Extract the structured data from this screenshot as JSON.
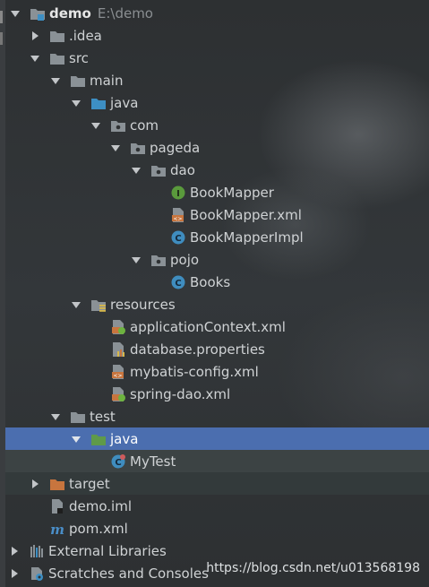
{
  "tree": {
    "root": {
      "label": "demo",
      "path": "E:\\demo"
    },
    "idea": "idea_label",
    "labels": {
      "idea": ".idea",
      "src": "src",
      "main": "main",
      "java_main": "java",
      "com": "com",
      "pageda": "pageda",
      "dao": "dao",
      "BookMapper": "BookMapper",
      "BookMapperXml": "BookMapper.xml",
      "BookMapperImpl": "BookMapperImpl",
      "pojo": "pojo",
      "Books": "Books",
      "resources": "resources",
      "applicationContext": "applicationContext.xml",
      "databaseProps": "database.properties",
      "mybatisConfig": "mybatis-config.xml",
      "springDao": "spring-dao.xml",
      "test": "test",
      "java_test": "java",
      "MyTest": "MyTest",
      "target": "target",
      "demoIml": "demo.iml",
      "pom": "pom.xml",
      "externalLibraries": "External Libraries",
      "scratches": "Scratches and Consoles"
    }
  },
  "watermark": "https://blog.csdn.net/u013568198",
  "colors": {
    "background": "#2f3234",
    "selection": "#4b6eaf",
    "folder": "#8a9196",
    "sourceFolder": "#3d8fc4",
    "testFolder": "#5f9a4a",
    "excludedFolder": "#c8753e"
  }
}
